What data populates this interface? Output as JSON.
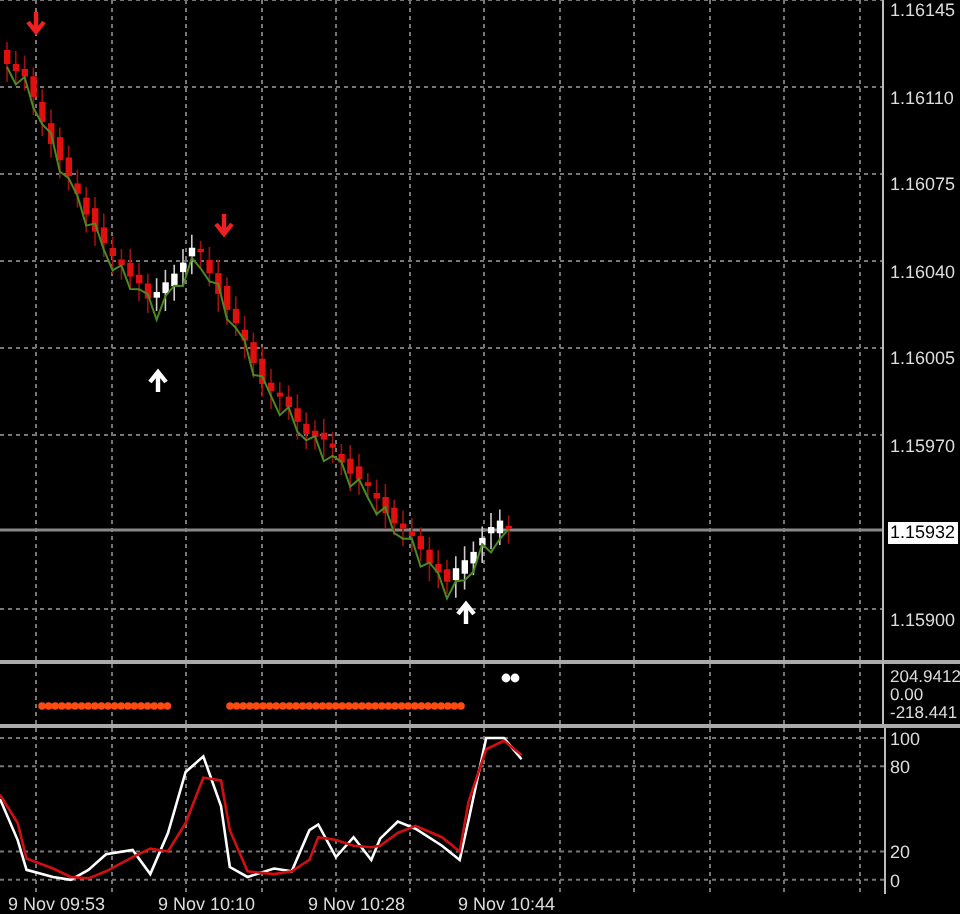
{
  "price_axis": {
    "labels": [
      {
        "text": "1.16145",
        "kind": "tick"
      },
      {
        "text": "1.16110",
        "kind": "tick"
      },
      {
        "text": "1.16075",
        "kind": "tick"
      },
      {
        "text": "1.16040",
        "kind": "tick"
      },
      {
        "text": "1.16005",
        "kind": "tick"
      },
      {
        "text": "1.15970",
        "kind": "tick"
      },
      {
        "text": "1.15932",
        "kind": "current"
      },
      {
        "text": "1.15900",
        "kind": "tick"
      }
    ]
  },
  "signal_panel": {
    "labels": [
      "204.9412",
      "0.00",
      "-218.441"
    ]
  },
  "oscillator_panel": {
    "labels": [
      "100",
      "80",
      "20",
      "0"
    ]
  },
  "time_axis": [
    "9 Nov 09:53",
    "9 Nov 10:10",
    "9 Nov 10:28",
    "9 Nov 10:44"
  ]
}
